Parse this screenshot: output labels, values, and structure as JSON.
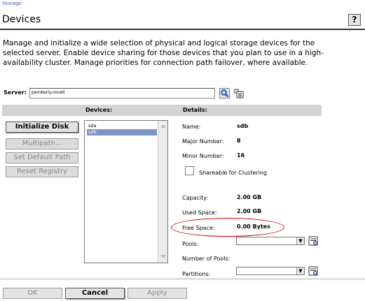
{
  "breadcrumb": "Storage",
  "title": "Devices",
  "help_label": "?",
  "description": "Manage and initialize a wide selection of physical and logical storage devices for the selected server. Enable device sharing for those devices that you plan to use in a high-availability cluster. Manage priorities for connection path failover, where available.",
  "server": {
    "label": "Server:",
    "value": "pemberly.novell"
  },
  "columns": {
    "devices": "Devices:",
    "details": "Details:"
  },
  "actions": {
    "initialize": "Initialize Disk",
    "multipath": "Multipath...",
    "set_default_path": "Set Default Path",
    "reset_registry": "Reset Registry"
  },
  "devices": [
    {
      "name": "sda",
      "selected": false
    },
    {
      "name": "sdb",
      "selected": true
    }
  ],
  "details": {
    "name_label": "Name:",
    "name_value": "sdb",
    "major_label": "Major Number:",
    "major_value": "8",
    "minor_label": "Minor Number:",
    "minor_value": "16",
    "shareable_label": "Shareable for Clustering",
    "capacity_label": "Capacity:",
    "capacity_value": "2.00 GB",
    "used_label": "Used Space:",
    "used_value": "2.00 GB",
    "free_label": "Free Space:",
    "free_value": "0.00 Bytes",
    "pools_label": "Pools:",
    "num_pools_label": "Number of Pools:",
    "partitions_label": "Partitions:"
  },
  "footer": {
    "ok": "OK",
    "cancel": "Cancel",
    "apply": "Apply"
  },
  "icons": [
    "search-icon",
    "server-browse-icon",
    "dropdown-arrow-icon",
    "details-icon"
  ],
  "colors": {
    "annotation": "#cc0000",
    "selection": "#7d95c5",
    "link": "#3355aa"
  }
}
